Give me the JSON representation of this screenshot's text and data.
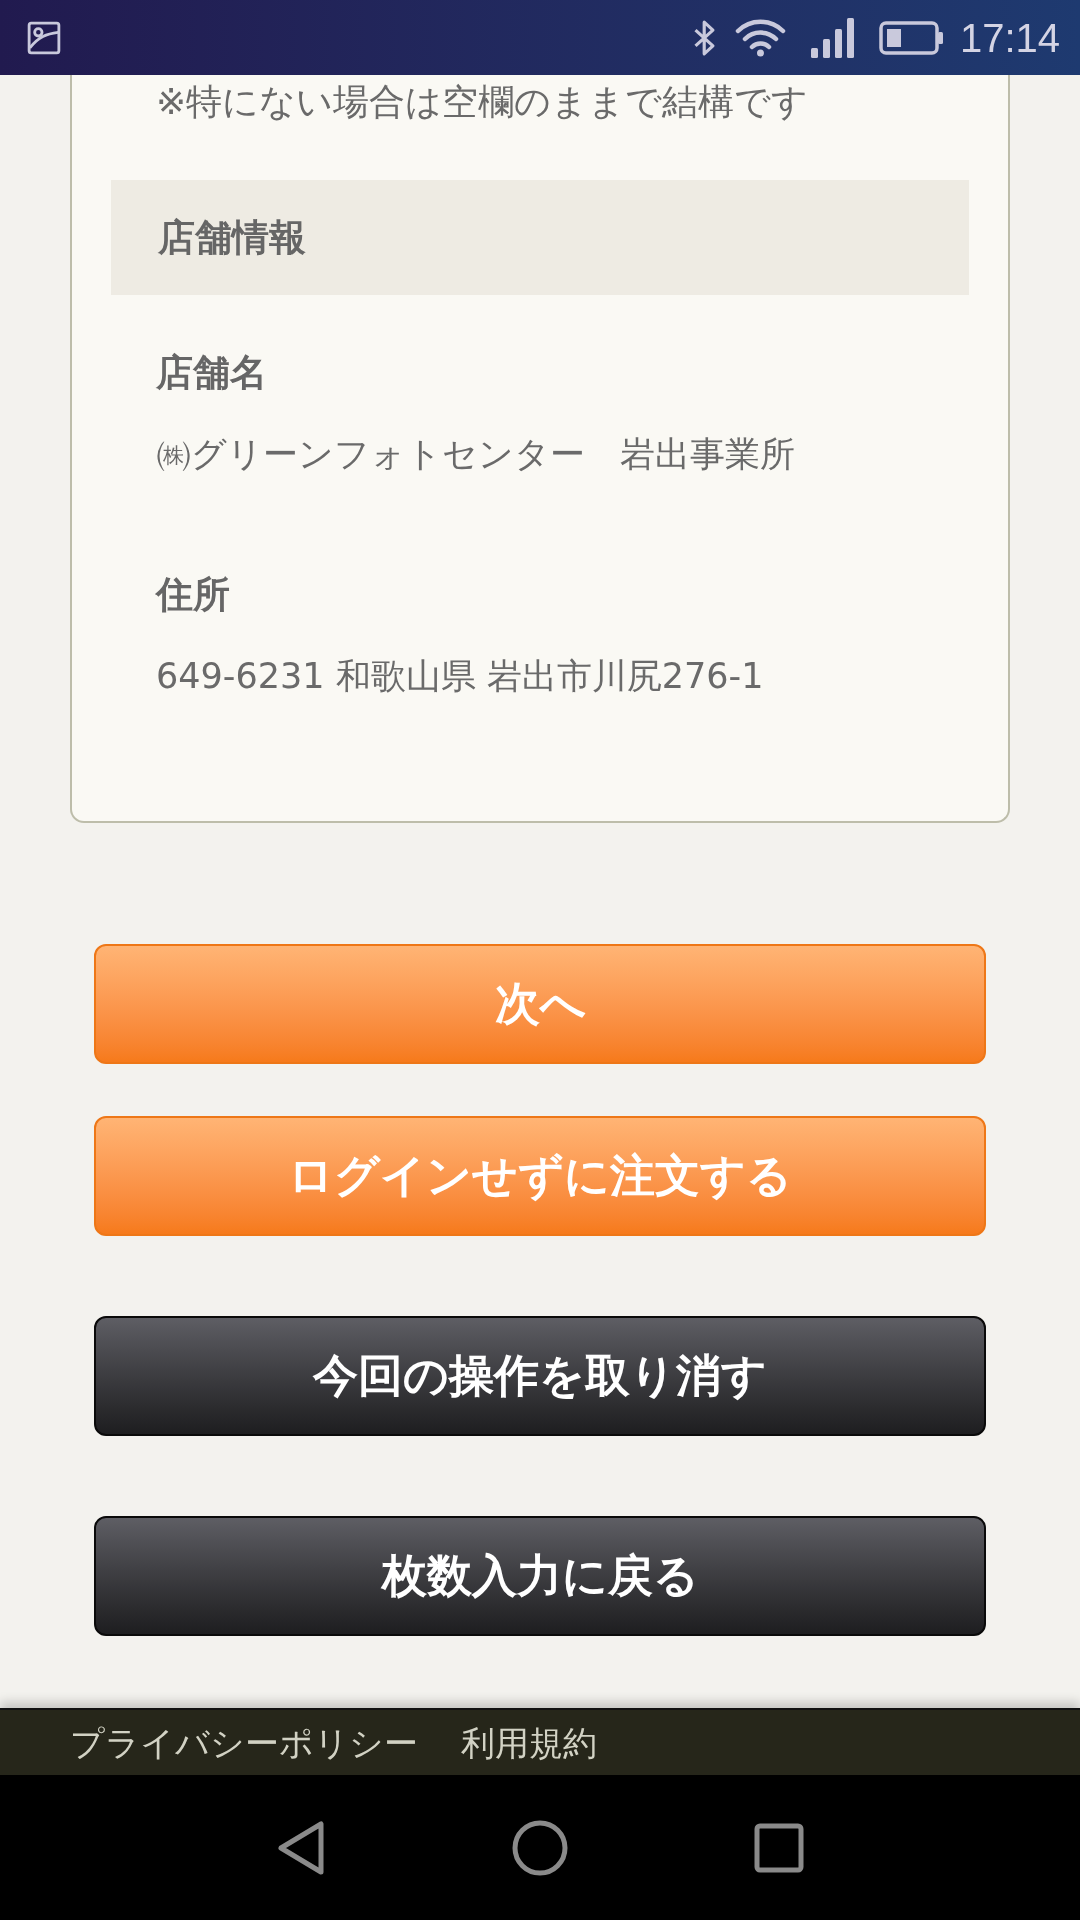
{
  "status_bar": {
    "time": "17:14"
  },
  "card": {
    "note": "※特にない場合は空欄のままで結構です",
    "section_title": "店舗情報",
    "fields": [
      {
        "label": "店舗名",
        "value": "㈱グリーンフォトセンター　岩出事業所"
      },
      {
        "label": "住所",
        "value": "649-6231 和歌山県 岩出市川尻276-1"
      }
    ]
  },
  "buttons": [
    {
      "label": "次へ",
      "kind": "primary"
    },
    {
      "label": "ログインせずに注文する",
      "kind": "primary"
    },
    {
      "label": "今回の操作を取り消す",
      "kind": "secondary"
    },
    {
      "label": "枚数入力に戻る",
      "kind": "secondary"
    }
  ],
  "footer": {
    "links": [
      "プライバシーポリシー",
      "利用規約"
    ]
  }
}
